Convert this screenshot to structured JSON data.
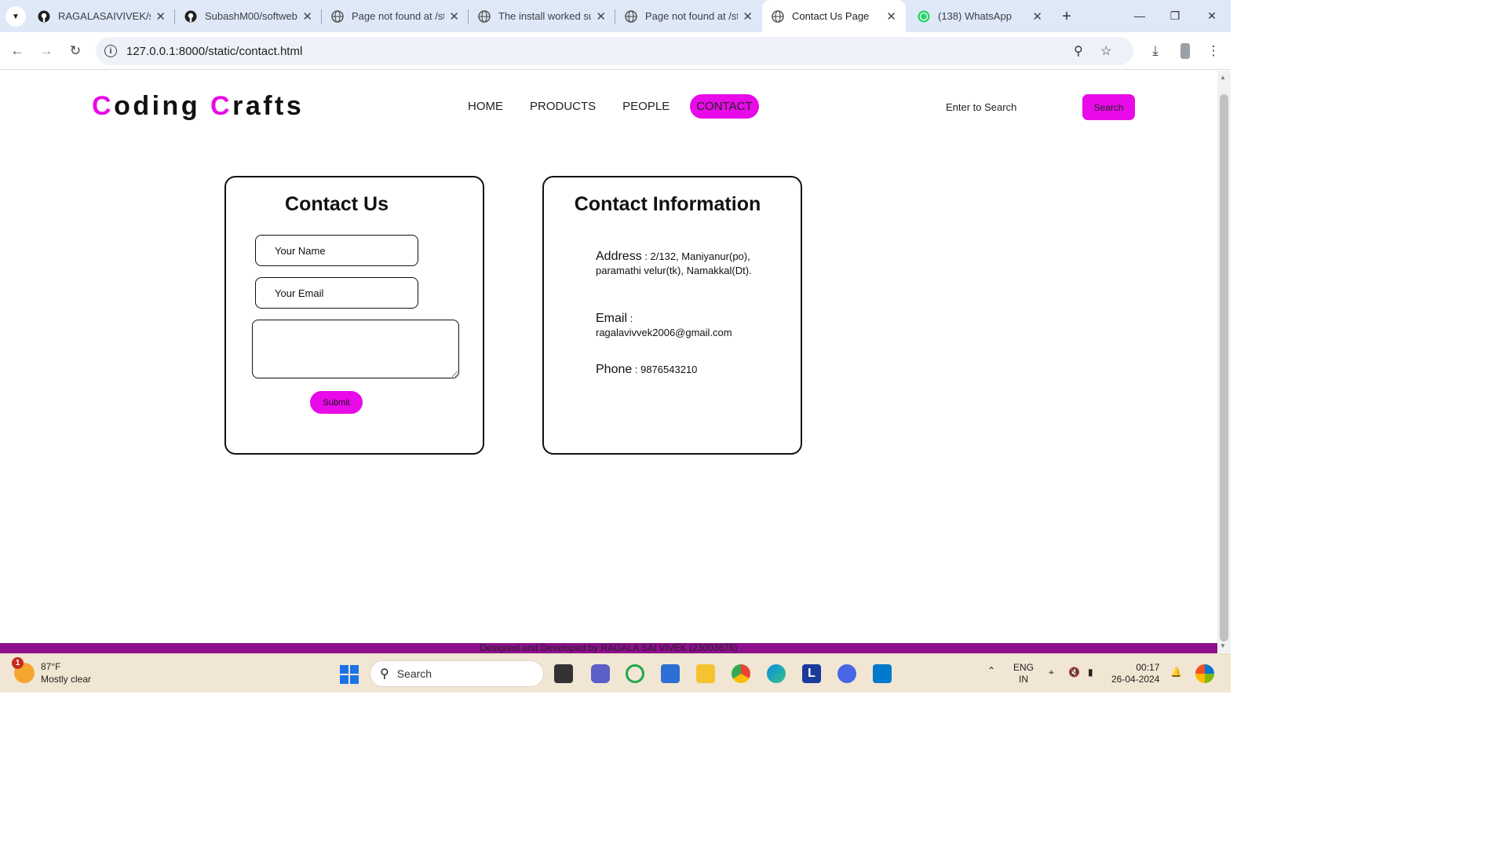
{
  "browser": {
    "tabs": [
      {
        "label": "RAGALASAIVIVEK/so",
        "icon": "github-icon",
        "active": false
      },
      {
        "label": "SubashM00/softweb",
        "icon": "github-icon",
        "active": false
      },
      {
        "label": "Page not found at /st",
        "icon": "globe-icon",
        "active": false
      },
      {
        "label": "The install worked su",
        "icon": "globe-icon",
        "active": false
      },
      {
        "label": "Page not found at /st",
        "icon": "globe-icon",
        "active": false
      },
      {
        "label": "Contact Us Page",
        "icon": "globe-icon",
        "active": true
      },
      {
        "label": "(138) WhatsApp",
        "icon": "whatsapp-icon",
        "active": false
      }
    ],
    "url": "127.0.0.1:8000/static/contact.html"
  },
  "site": {
    "brand_first_initial": "C",
    "brand_first_rest": "oding ",
    "brand_second_initial": "C",
    "brand_second_rest": "rafts",
    "nav": [
      {
        "label": "HOME",
        "active": false
      },
      {
        "label": "PRODUCTS",
        "active": false
      },
      {
        "label": "PEOPLE",
        "active": false
      },
      {
        "label": "CONTACT",
        "active": true
      }
    ],
    "search_placeholder": "Enter to Search",
    "search_button": "Search",
    "accent_color": "#e80ae8"
  },
  "contact_form": {
    "title": "Contact Us",
    "name_placeholder": "Your Name",
    "email_placeholder": "Your Email",
    "message_value": "",
    "submit_label": "Submit"
  },
  "contact_info": {
    "title": "Contact Information",
    "address_label": "Address",
    "address_value": " : 2/132, Maniyanur(po), paramathi velur(tk), Namakkal(Dt).",
    "email_label": "Email",
    "email_value": " : ragalavivvek2006@gmail.com",
    "phone_label": "Phone",
    "phone_value": " : 9876543210"
  },
  "footer": {
    "text": "Designed and Developed by RAGALA SAI VIVEK (23003676)",
    "color": "#8d0f8d"
  },
  "taskbar": {
    "weather_temp": "87°F",
    "weather_desc": "Mostly clear",
    "weather_badge": "1",
    "search_label": "Search",
    "lang_line1": "ENG",
    "lang_line2": "IN",
    "time": "00:17",
    "date": "26-04-2024"
  }
}
